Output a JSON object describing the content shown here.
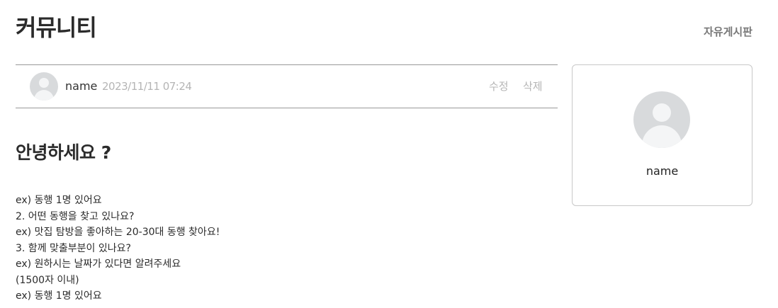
{
  "header": {
    "title": "커뮤니티",
    "board_link": "자유게시판"
  },
  "post": {
    "author": "name",
    "date": "2023/11/11 07:24",
    "edit_label": "수정",
    "delete_label": "삭제",
    "title": "안녕하세요 ?",
    "body_lines": [
      "ex) 동행 1명 있어요",
      "2. 어떤 동행을 찾고 있나요?",
      "ex) 맛집 탐방을 좋아하는 20-30대 동행 찾아요!",
      "3. 함께 맞출부분이 있나요?",
      "ex) 원하시는 날짜가 있다면 알려주세요",
      "(1500자 이내)",
      "ex) 동행 1명 있어요"
    ]
  },
  "profile": {
    "name": "name"
  },
  "icons": {
    "author_avatar": "user-avatar-icon",
    "profile_avatar": "user-avatar-icon"
  }
}
